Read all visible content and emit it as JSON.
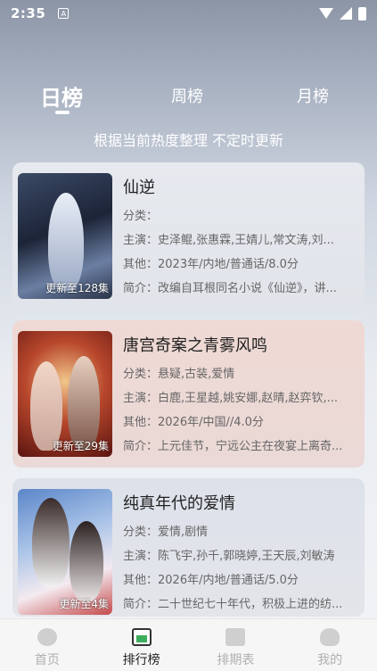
{
  "status": {
    "time": "2:35",
    "notif": "A"
  },
  "tabs": [
    {
      "label": "日榜",
      "active": true
    },
    {
      "label": "周榜",
      "active": false
    },
    {
      "label": "月榜",
      "active": false
    }
  ],
  "subtitle": "根据当前热度整理 不定时更新",
  "items": [
    {
      "title": "仙逆",
      "badge": "更新至128集",
      "category": "分类：",
      "cast": "主演：史泽鲲,张惠霖,王婧儿,常文涛,刘...",
      "other": "其他：2023年/内地/普通话/8.0分",
      "intro": "简介：改编自耳根同名小说《仙逆》，讲..."
    },
    {
      "title": "唐宫奇案之青雾风鸣",
      "badge": "更新至29集",
      "category": "分类：悬疑,古装,爱情",
      "cast": "主演：白鹿,王星越,姚安娜,赵晴,赵弈钦,...",
      "other": "其他：2026年/中国//4.0分",
      "intro": "简介：上元佳节，宁远公主在夜宴上离奇..."
    },
    {
      "title": "纯真年代的爱情",
      "badge": "更新至4集",
      "category": "分类：爱情,剧情",
      "cast": "主演：陈飞宇,孙千,郭晓婷,王天辰,刘敏涛",
      "other": "其他：2026年/内地/普通话/5.0分",
      "intro": "简介：二十世纪七十年代，积极上进的纺..."
    }
  ],
  "nav": [
    {
      "label": "首页",
      "icon": "home-icon"
    },
    {
      "label": "排行榜",
      "icon": "rank-icon"
    },
    {
      "label": "排期表",
      "icon": "calendar-icon"
    },
    {
      "label": "我的",
      "icon": "profile-icon"
    }
  ]
}
